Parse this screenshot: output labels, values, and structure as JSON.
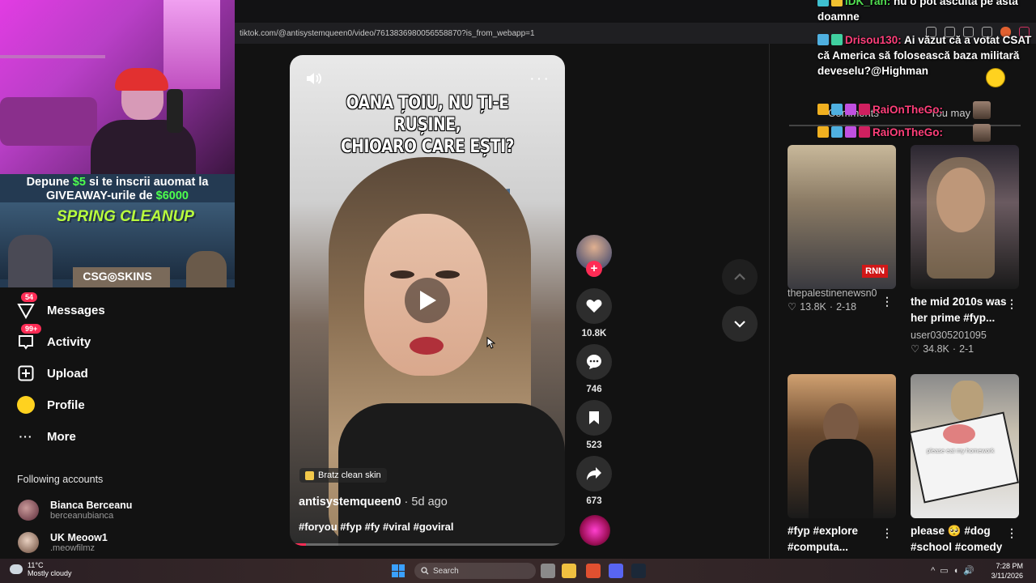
{
  "browser": {
    "url": "tiktok.com/@antisystemqueen0/video/7613836980056558870?is_from_webapp=1"
  },
  "webcam_promo": {
    "line1_prefix": "Depune ",
    "line1_amount": "$5",
    "line1_suffix": " si te inscrii auomat la",
    "line2_prefix": "GIVEAWAY-urile de ",
    "line2_amount": "$6000",
    "title": "SPRING CLEANUP",
    "logo": "CSG◎SKINS"
  },
  "sidebar": {
    "items": [
      {
        "label": "Messages",
        "badge": "54",
        "icon": "paper-plane-icon"
      },
      {
        "label": "Activity",
        "badge": "99+",
        "icon": "inbox-icon"
      },
      {
        "label": "Upload",
        "badge": "",
        "icon": "plus-square-icon"
      },
      {
        "label": "Profile",
        "badge": "",
        "icon": "avatar-icon"
      },
      {
        "label": "More",
        "badge": "",
        "icon": "dots-icon"
      }
    ],
    "following_title": "Following accounts",
    "following": [
      {
        "name": "Bianca Berceanu",
        "handle": "berceanubianca"
      },
      {
        "name": "UK Meoow1",
        "handle": ".meowfilmz"
      }
    ]
  },
  "video": {
    "caption_line1": "OANA ȚOIU, NU ȚI-E RUȘINE,",
    "caption_line2": "CHIOARO CARE EȘTI?",
    "effect_tag": "Bratz clean skin",
    "author": "antisystemqueen0",
    "time": " · 5d ago",
    "hashtags": "#foryou #fyp #fy #viral #goviral",
    "progress": 0.06
  },
  "actions": {
    "likes": "10.8K",
    "comments": "746",
    "saves": "523",
    "shares": "673"
  },
  "right_panel": {
    "tab_comments": "Comments",
    "tab_you_may": "You may",
    "cards": [
      {
        "title": "",
        "author": "thepalestinenewsn0",
        "likes": "13.8K",
        "date": "2-18",
        "thumb_label": "RNN"
      },
      {
        "title": "the mid 2010s was her prime #fyp...",
        "author": "user0305201095",
        "likes": "34.8K",
        "date": "2-1",
        "thumb_label": ""
      },
      {
        "title": "#fyp #explore #computa...",
        "author": "",
        "likes": "",
        "date": "",
        "thumb_label": ""
      },
      {
        "title": "please 🥺 #dog #school #comedy",
        "author": "",
        "likes": "",
        "date": "",
        "thumb_label": "please eat my homework"
      }
    ]
  },
  "chat": {
    "messages": [
      {
        "user": "IDK_ran:",
        "text": " nu o pot asculta pe asta doamne"
      },
      {
        "user": "Drisou130:",
        "text": " Ai văzut că a votat CSAT că America să folosească baza militară deveselu?@Highman"
      },
      {
        "user": "RaiOnTheGo:",
        "text": ""
      },
      {
        "user": "RaiOnTheGo:",
        "text": ""
      }
    ]
  },
  "taskbar": {
    "temperature": "11°C",
    "weather": "Mostly cloudy",
    "search": "Search",
    "time": "7:28 PM",
    "date": "3/11/2026"
  }
}
